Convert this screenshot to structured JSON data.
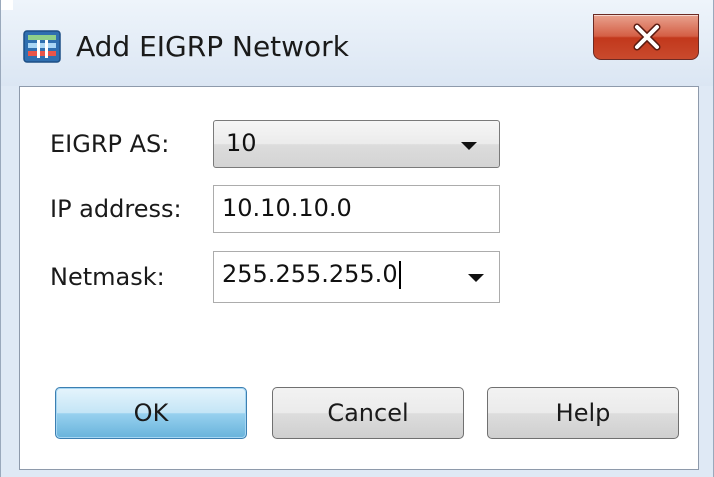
{
  "window": {
    "title": "Add EIGRP Network",
    "close_glyph": "X"
  },
  "form": {
    "eigrp_as_label": "EIGRP AS:",
    "eigrp_as_value": "10",
    "ip_address_label": "IP address:",
    "ip_address_value": "10.10.10.0",
    "netmask_label": "Netmask:",
    "netmask_value": "255.255.255.0"
  },
  "buttons": {
    "ok": "OK",
    "cancel": "Cancel",
    "help": "Help"
  },
  "icons": {
    "app": "network-config-icon",
    "close": "close-icon",
    "dropdown": "chevron-down-icon"
  },
  "colors": {
    "close_button": "#c94a2d",
    "default_button": "#98d1ef",
    "window_frame": "#dfe9f5"
  }
}
